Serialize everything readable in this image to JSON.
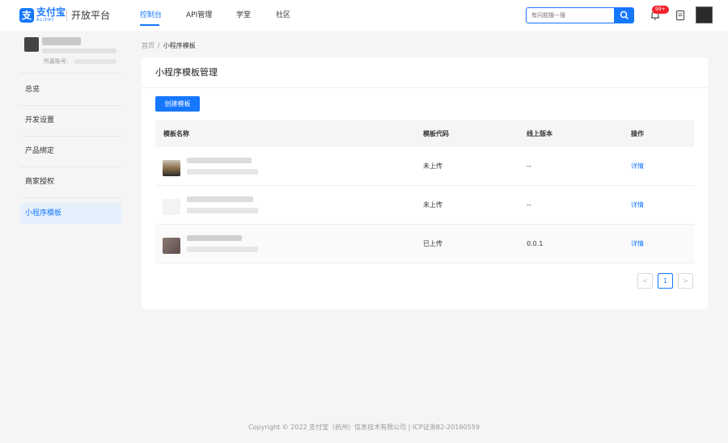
{
  "header": {
    "logo_text": "支付宝",
    "logo_sub": "ALIPAY",
    "platform": "开放平台",
    "nav": [
      "控制台",
      "API管理",
      "学堂",
      "社区"
    ],
    "search_placeholder": "有问题搜一搜",
    "badge": "99+"
  },
  "sidebar": {
    "account_label": "所属账号：",
    "items": [
      "总览",
      "开发设置",
      "产品绑定",
      "商家授权",
      "小程序模板"
    ]
  },
  "breadcrumb": {
    "home": "首页",
    "sep": "/",
    "current": "小程序模板"
  },
  "card": {
    "title": "小程序模板管理",
    "create_button": "创建模板",
    "columns": [
      "模板名称",
      "模板代码",
      "线上版本",
      "操作"
    ],
    "rows": [
      {
        "status": "未上传",
        "version": "--",
        "action": "详情"
      },
      {
        "status": "未上传",
        "version": "--",
        "action": "详情"
      },
      {
        "status": "已上传",
        "version": "0.0.1",
        "action": "详情"
      }
    ]
  },
  "pagination": {
    "prev": "<",
    "current": "1",
    "next": ">"
  },
  "footer": "Copyright © 2022 支付宝（杭州）信息技术有限公司 | ICP证浙B2-20160559"
}
